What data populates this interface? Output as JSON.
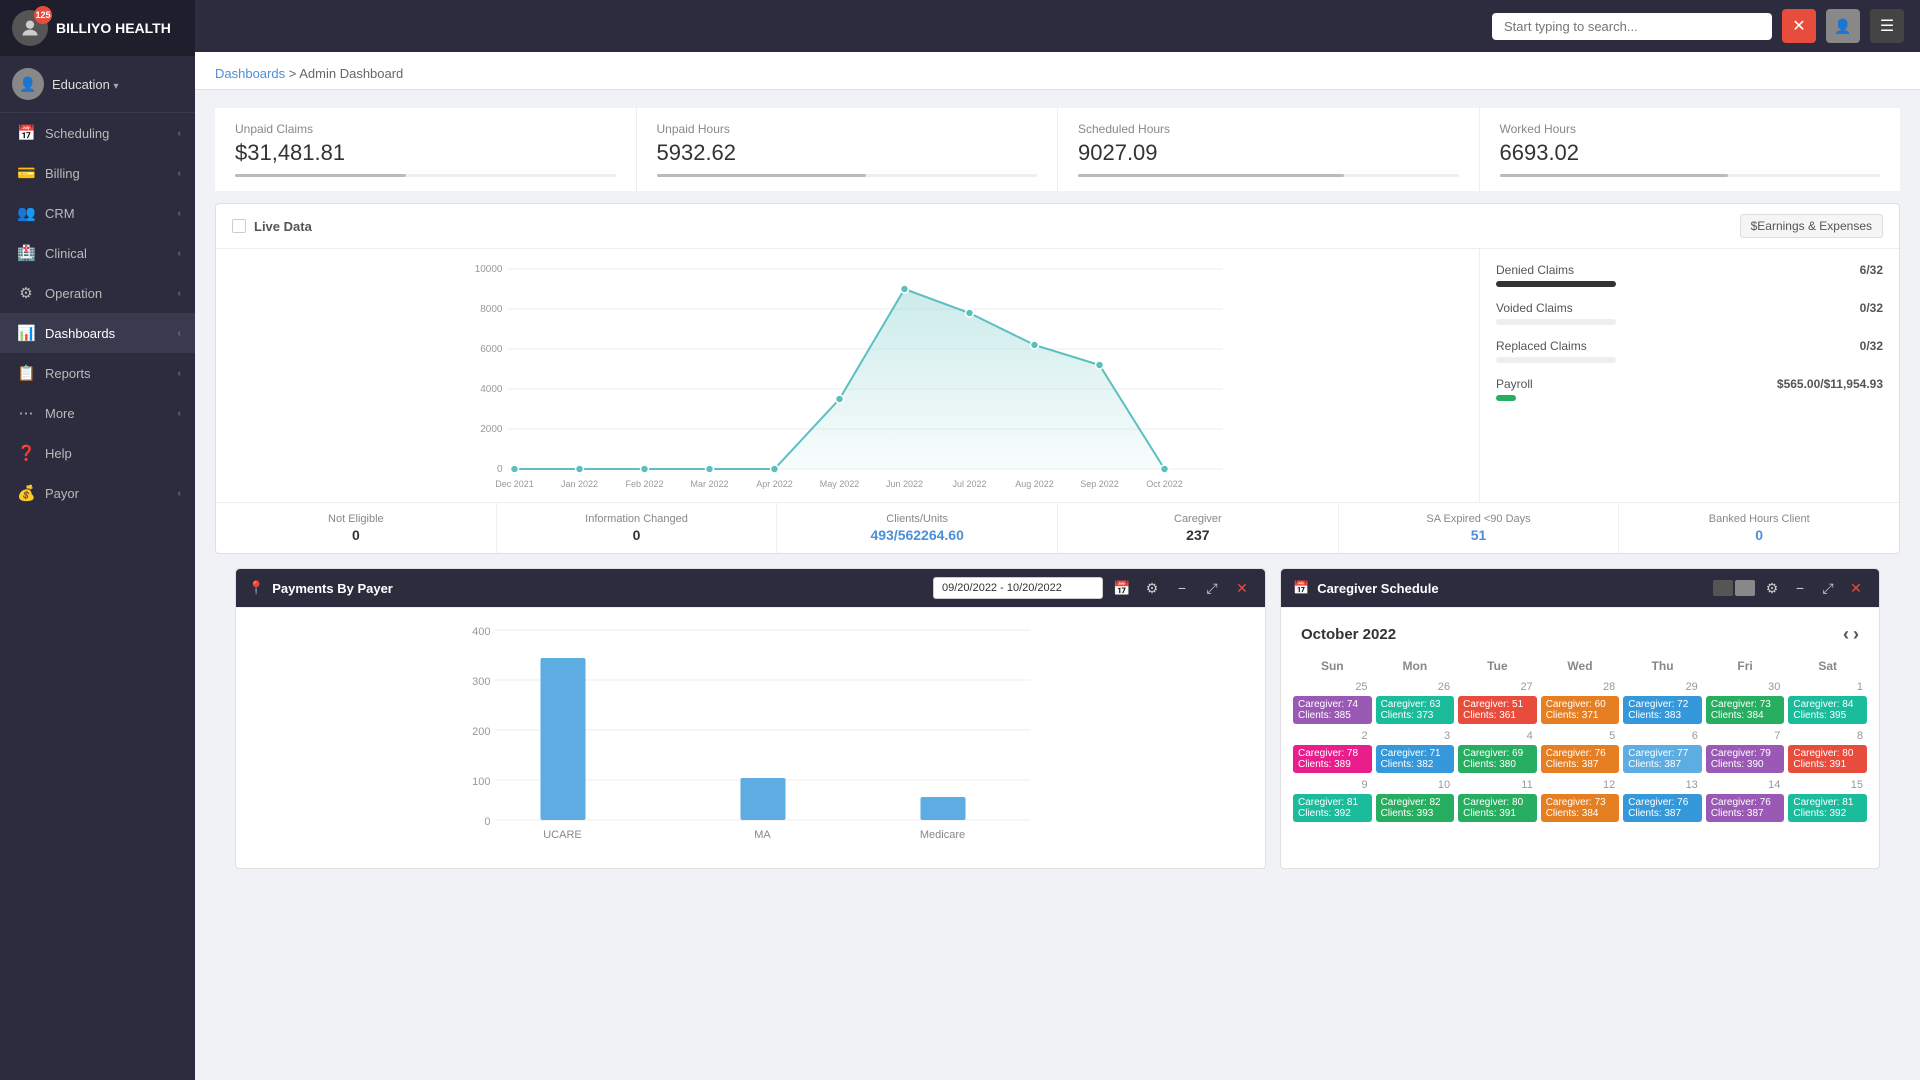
{
  "app": {
    "name": "BILLIYO HEALTH",
    "notification_count": "125"
  },
  "topbar": {
    "search_placeholder": "Start typing to search...",
    "close_btn": "✕",
    "user_btn": "👤",
    "menu_btn": "☰"
  },
  "user": {
    "name": "Education",
    "chevron": "▾",
    "avatar": "👤"
  },
  "nav": {
    "items": [
      {
        "id": "scheduling",
        "label": "Scheduling",
        "icon": "📅"
      },
      {
        "id": "billing",
        "label": "Billing",
        "icon": "💳"
      },
      {
        "id": "crm",
        "label": "CRM",
        "icon": "👥"
      },
      {
        "id": "clinical",
        "label": "Clinical",
        "icon": "🏥"
      },
      {
        "id": "operation",
        "label": "Operation",
        "icon": "⚙"
      },
      {
        "id": "dashboards",
        "label": "Dashboards",
        "icon": "📊",
        "active": true
      },
      {
        "id": "reports",
        "label": "Reports",
        "icon": "📋"
      },
      {
        "id": "more",
        "label": "More",
        "icon": "⋯"
      },
      {
        "id": "help",
        "label": "Help",
        "icon": "❓"
      },
      {
        "id": "payor",
        "label": "Payor",
        "icon": "💰"
      }
    ]
  },
  "breadcrumb": {
    "parent": "Dashboards",
    "current": "Admin Dashboard"
  },
  "stats": [
    {
      "label": "Unpaid Claims",
      "value": "$31,481.81",
      "bar_pct": 45
    },
    {
      "label": "Unpaid Hours",
      "value": "5932.62",
      "bar_pct": 55
    },
    {
      "label": "Scheduled Hours",
      "value": "9027.09",
      "bar_pct": 70
    },
    {
      "label": "Worked Hours",
      "value": "6693.02",
      "bar_pct": 60
    }
  ],
  "live_data": {
    "title": "Live Data",
    "earnings_btn": "$Earnings & Expenses",
    "chart": {
      "y_labels": [
        "10000",
        "8000",
        "6000",
        "4000",
        "2000",
        "0"
      ],
      "x_labels": [
        "Dec 2021",
        "Jan 2022",
        "Feb 2022",
        "Mar 2022",
        "Apr 2022",
        "May 2022",
        "Jun 2022",
        "Jul 2022",
        "Aug 2022",
        "Sep 2022",
        "Oct 2022"
      ]
    },
    "claims": [
      {
        "label": "Denied Claims",
        "value": "6/32",
        "color": "dark",
        "pct": 50
      },
      {
        "label": "Voided Claims",
        "value": "0/32",
        "color": "empty",
        "pct": 0
      },
      {
        "label": "Replaced Claims",
        "value": "0/32",
        "color": "empty",
        "pct": 0
      },
      {
        "label": "Payroll",
        "value": "$565.00/$11,954.93",
        "color": "green",
        "pct": 10
      }
    ],
    "footer": [
      {
        "label": "Not Eligible",
        "value": "0",
        "colored": false
      },
      {
        "label": "Information Changed",
        "value": "0",
        "colored": false
      },
      {
        "label": "Clients/Units",
        "value": "493/562264.60",
        "colored": true
      },
      {
        "label": "Caregiver",
        "value": "237",
        "colored": false
      },
      {
        "label": "SA Expired <90 Days",
        "value": "51",
        "colored": true
      },
      {
        "label": "Banked Hours Client",
        "value": "0",
        "colored": true
      }
    ]
  },
  "payments_by_payer": {
    "title": "Payments By Payer",
    "date_range": "09/20/2022 - 10/20/2022",
    "y_labels": [
      "400",
      "300",
      "200",
      "100",
      "0"
    ],
    "bars": [
      {
        "label": "UCARE",
        "height_pct": 85,
        "color": "#5dade2"
      },
      {
        "label": "MA",
        "height_pct": 22,
        "color": "#5dade2"
      },
      {
        "label": "Medicare",
        "height_pct": 12,
        "color": "#5dade2"
      }
    ]
  },
  "caregiver_schedule": {
    "title": "Caregiver Schedule",
    "month": "October 2022",
    "days": [
      "Sun",
      "Mon",
      "Tue",
      "Wed",
      "Thu",
      "Fri",
      "Sat"
    ],
    "weeks": [
      {
        "dates": [
          "25",
          "26",
          "27",
          "28",
          "29",
          "30",
          "1"
        ],
        "events": [
          {
            "color": "purple",
            "text": "Caregiver: 74\nClients: 385"
          },
          {
            "color": "teal",
            "text": "Caregiver: 63\nClients: 373"
          },
          {
            "color": "red",
            "text": "Caregiver: 51\nClients: 361"
          },
          {
            "color": "orange",
            "text": "Caregiver: 60\nClients: 371"
          },
          {
            "color": "blue",
            "text": "Caregiver: 72\nClients: 383"
          },
          {
            "color": "green",
            "text": "Caregiver: 73\nClients: 384"
          },
          {
            "color": "teal",
            "text": "Caregiver: 84\nClients: 395"
          }
        ]
      },
      {
        "dates": [
          "2",
          "3",
          "4",
          "5",
          "6",
          "7",
          "8"
        ],
        "events": [
          {
            "color": "pink",
            "text": "Caregiver: 78\nClients: 389"
          },
          {
            "color": "blue",
            "text": "Caregiver: 71\nClients: 382"
          },
          {
            "color": "green",
            "text": "Caregiver: 69\nClients: 380"
          },
          {
            "color": "orange",
            "text": "Caregiver: 76\nClients: 387"
          },
          {
            "color": "light-blue",
            "text": "Caregiver: 77\nClients: 387"
          },
          {
            "color": "purple",
            "text": "Caregiver: 79\nClients: 390"
          },
          {
            "color": "red",
            "text": "Caregiver: 80\nClients: 391"
          }
        ]
      },
      {
        "dates": [
          "9",
          "10",
          "11",
          "12",
          "13",
          "14",
          "15"
        ],
        "events": [
          {
            "color": "teal",
            "text": "Caregiver: 81\nClients: 392"
          },
          {
            "color": "green",
            "text": "Caregiver: 82\nClients: 393"
          },
          {
            "color": "green",
            "text": "Caregiver: 80\nClients: 391"
          },
          {
            "color": "orange",
            "text": "Caregiver: 73\nClients: 384"
          },
          {
            "color": "blue",
            "text": "Caregiver: 76\nClients: 387"
          },
          {
            "color": "purple",
            "text": "Caregiver: 76\nClients: 387"
          },
          {
            "color": "teal",
            "text": "Caregiver: 81\nClients: 392"
          }
        ]
      }
    ]
  }
}
